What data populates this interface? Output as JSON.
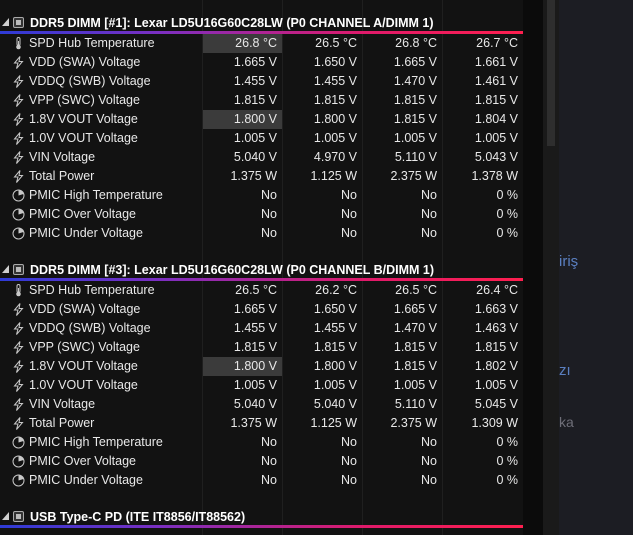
{
  "groups": [
    {
      "title": "DDR5 DIMM [#1]: Lexar LD5U16G60C28LW (P0 CHANNEL A/DIMM 1)",
      "rows": [
        {
          "label": "SPD Hub Temperature",
          "icon": "thermometer-icon",
          "v": [
            "26.8 °C",
            "26.5 °C",
            "26.8 °C",
            "26.7 °C"
          ],
          "hl": true
        },
        {
          "label": "VDD (SWA) Voltage",
          "icon": "bolt-icon",
          "v": [
            "1.665 V",
            "1.650 V",
            "1.665 V",
            "1.661 V"
          ],
          "hl": false
        },
        {
          "label": "VDDQ (SWB) Voltage",
          "icon": "bolt-icon",
          "v": [
            "1.455 V",
            "1.455 V",
            "1.470 V",
            "1.461 V"
          ],
          "hl": false
        },
        {
          "label": "VPP (SWC) Voltage",
          "icon": "bolt-icon",
          "v": [
            "1.815 V",
            "1.815 V",
            "1.815 V",
            "1.815 V"
          ],
          "hl": false
        },
        {
          "label": "1.8V VOUT Voltage",
          "icon": "bolt-icon",
          "v": [
            "1.800 V",
            "1.800 V",
            "1.815 V",
            "1.804 V"
          ],
          "hl": true
        },
        {
          "label": "1.0V VOUT Voltage",
          "icon": "bolt-icon",
          "v": [
            "1.005 V",
            "1.005 V",
            "1.005 V",
            "1.005 V"
          ],
          "hl": false
        },
        {
          "label": "VIN Voltage",
          "icon": "bolt-icon",
          "v": [
            "5.040 V",
            "4.970 V",
            "5.110 V",
            "5.043 V"
          ],
          "hl": false
        },
        {
          "label": "Total Power",
          "icon": "bolt-icon",
          "v": [
            "1.375 W",
            "1.125 W",
            "2.375 W",
            "1.378 W"
          ],
          "hl": false
        },
        {
          "label": "PMIC High Temperature",
          "icon": "clock-icon",
          "v": [
            "No",
            "No",
            "No",
            "0 %"
          ],
          "hl": false
        },
        {
          "label": "PMIC Over Voltage",
          "icon": "clock-icon",
          "v": [
            "No",
            "No",
            "No",
            "0 %"
          ],
          "hl": false
        },
        {
          "label": "PMIC Under Voltage",
          "icon": "clock-icon",
          "v": [
            "No",
            "No",
            "No",
            "0 %"
          ],
          "hl": false
        }
      ]
    },
    {
      "title": "DDR5 DIMM [#3]: Lexar LD5U16G60C28LW (P0 CHANNEL B/DIMM 1)",
      "rows": [
        {
          "label": "SPD Hub Temperature",
          "icon": "thermometer-icon",
          "v": [
            "26.5 °C",
            "26.2 °C",
            "26.5 °C",
            "26.4 °C"
          ],
          "hl": false
        },
        {
          "label": "VDD (SWA) Voltage",
          "icon": "bolt-icon",
          "v": [
            "1.665 V",
            "1.650 V",
            "1.665 V",
            "1.663 V"
          ],
          "hl": false
        },
        {
          "label": "VDDQ (SWB) Voltage",
          "icon": "bolt-icon",
          "v": [
            "1.455 V",
            "1.455 V",
            "1.470 V",
            "1.463 V"
          ],
          "hl": false
        },
        {
          "label": "VPP (SWC) Voltage",
          "icon": "bolt-icon",
          "v": [
            "1.815 V",
            "1.815 V",
            "1.815 V",
            "1.815 V"
          ],
          "hl": false
        },
        {
          "label": "1.8V VOUT Voltage",
          "icon": "bolt-icon",
          "v": [
            "1.800 V",
            "1.800 V",
            "1.815 V",
            "1.802 V"
          ],
          "hl": true
        },
        {
          "label": "1.0V VOUT Voltage",
          "icon": "bolt-icon",
          "v": [
            "1.005 V",
            "1.005 V",
            "1.005 V",
            "1.005 V"
          ],
          "hl": false
        },
        {
          "label": "VIN Voltage",
          "icon": "bolt-icon",
          "v": [
            "5.040 V",
            "5.040 V",
            "5.110 V",
            "5.045 V"
          ],
          "hl": false
        },
        {
          "label": "Total Power",
          "icon": "bolt-icon",
          "v": [
            "1.375 W",
            "1.125 W",
            "2.375 W",
            "1.309 W"
          ],
          "hl": false
        },
        {
          "label": "PMIC High Temperature",
          "icon": "clock-icon",
          "v": [
            "No",
            "No",
            "No",
            "0 %"
          ],
          "hl": false
        },
        {
          "label": "PMIC Over Voltage",
          "icon": "clock-icon",
          "v": [
            "No",
            "No",
            "No",
            "0 %"
          ],
          "hl": false
        },
        {
          "label": "PMIC Under Voltage",
          "icon": "clock-icon",
          "v": [
            "No",
            "No",
            "No",
            "0 %"
          ],
          "hl": false
        }
      ]
    },
    {
      "title": "USB Type-C PD (ITE IT8856/IT88562)",
      "rows": []
    }
  ],
  "right_pane": {
    "frag1": "iriş",
    "frag2": "zı",
    "frag3": "ka"
  },
  "colors": {
    "accent_bar_start": "#2e3bd6",
    "accent_bar_end": "#ff1f4f",
    "highlight": "#3b3b3b"
  }
}
